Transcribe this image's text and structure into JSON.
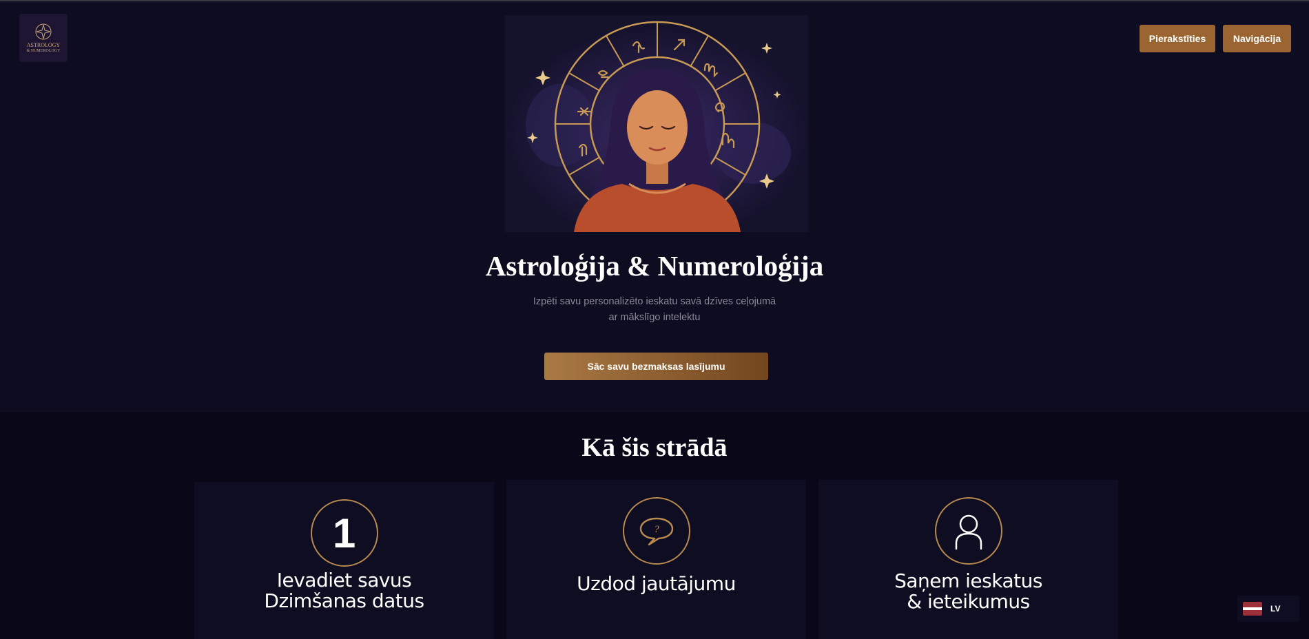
{
  "header": {
    "logo_line1": "ASTROLOGY",
    "logo_line2": "& NUMEROLOGY",
    "signup_label": "Pierakstīties",
    "nav_label": "Navigācija"
  },
  "hero": {
    "title": "Astroloģija & Numeroloģija",
    "subtitle_line1": "Izpēti savu personalizēto ieskatu savā dzīves ceļojumā",
    "subtitle_line2": "ar mākslīgo intelektu",
    "cta_label": "Sāc savu bezmaksas lasījumu"
  },
  "how_it_works": {
    "title": "Kā šis strādā",
    "steps": [
      {
        "number": "1",
        "label_line1": "Ievadiet savus",
        "label_line2": "Dzimšanas datus",
        "icon": "number-one-icon"
      },
      {
        "label_line1": "Uzdod jautājumu",
        "icon": "speech-bubble-question-icon"
      },
      {
        "label_line1": "Saņem ieskatus",
        "label_line2": "& ieteikumus",
        "icon": "user-icon"
      }
    ]
  },
  "language": {
    "code": "LV",
    "flag": "latvia-flag-icon"
  },
  "colors": {
    "accent": "#9a6531",
    "gold": "#b88a4d",
    "background": "#0e0c20"
  }
}
